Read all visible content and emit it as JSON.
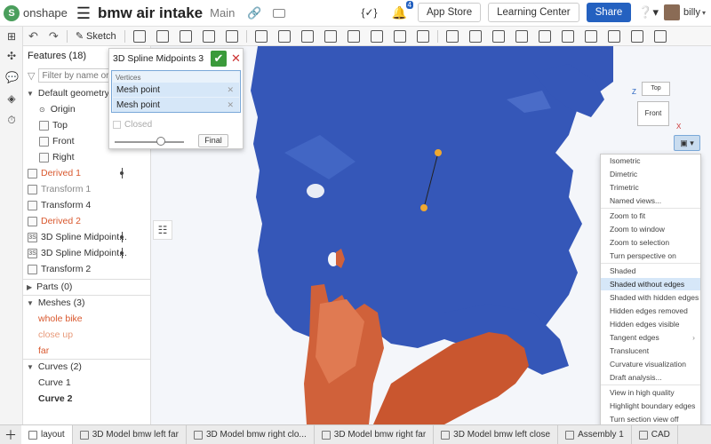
{
  "topbar": {
    "logo_letter": "S",
    "logo_text": "onshape",
    "doc_title": "bmw air intake",
    "branch": "Main",
    "notifications": "4",
    "app_store": "App Store",
    "learning_center": "Learning Center",
    "share": "Share",
    "username": "billy"
  },
  "toolbar": {
    "sketch_label": "Sketch"
  },
  "features": {
    "header": "Features (18)",
    "filter_placeholder": "Filter by name or type",
    "items": [
      {
        "label": "Default geometry"
      },
      {
        "label": "Origin"
      },
      {
        "label": "Top"
      },
      {
        "label": "Front"
      },
      {
        "label": "Right"
      },
      {
        "label": "Derived 1"
      },
      {
        "label": "Transform 1"
      },
      {
        "label": "Transform 4"
      },
      {
        "label": "Derived 2"
      },
      {
        "label": "3D Spline Midpoint..."
      },
      {
        "label": "3D Spline Midpoint..."
      },
      {
        "label": "Transform 2"
      }
    ],
    "parts": "Parts (0)",
    "meshes": "Meshes (3)",
    "mesh_items": [
      "whole bike",
      "close up",
      "far"
    ],
    "curves": "Curves (2)",
    "curve_items": [
      "Curve 1",
      "Curve 2"
    ]
  },
  "dialog": {
    "title": "3D Spline Midpoints 3",
    "vertices_label": "Vertices",
    "vertices": [
      "Mesh point",
      "Mesh point"
    ],
    "closed_label": "Closed",
    "final_label": "Final"
  },
  "viewcube": {
    "top": "Top",
    "front": "Front",
    "z": "Z",
    "x": "X"
  },
  "view_menu": {
    "items": [
      "Isometric",
      "Dimetric",
      "Trimetric",
      "Named views...",
      "Zoom to fit",
      "Zoom to window",
      "Zoom to selection",
      "Turn perspective on",
      "Shaded",
      "Shaded without edges",
      "Shaded with hidden edges",
      "Hidden edges removed",
      "Hidden edges visible",
      "Tangent edges",
      "Translucent",
      "Curvature visualization",
      "Draft analysis...",
      "View in high quality",
      "Highlight boundary edges",
      "Turn section view off"
    ],
    "active": "Shaded without edges"
  },
  "tabs": {
    "items": [
      "layout",
      "3D Model bmw left far",
      "3D Model bmw right clo...",
      "3D Model bmw right far",
      "3D Model bmw left close",
      "Assembly 1",
      "CAD"
    ]
  },
  "colors": {
    "accent": "#2461c0",
    "mesh_blue": "#3557b8",
    "mesh_orange": "#d0613a",
    "point": "#f0a830"
  }
}
